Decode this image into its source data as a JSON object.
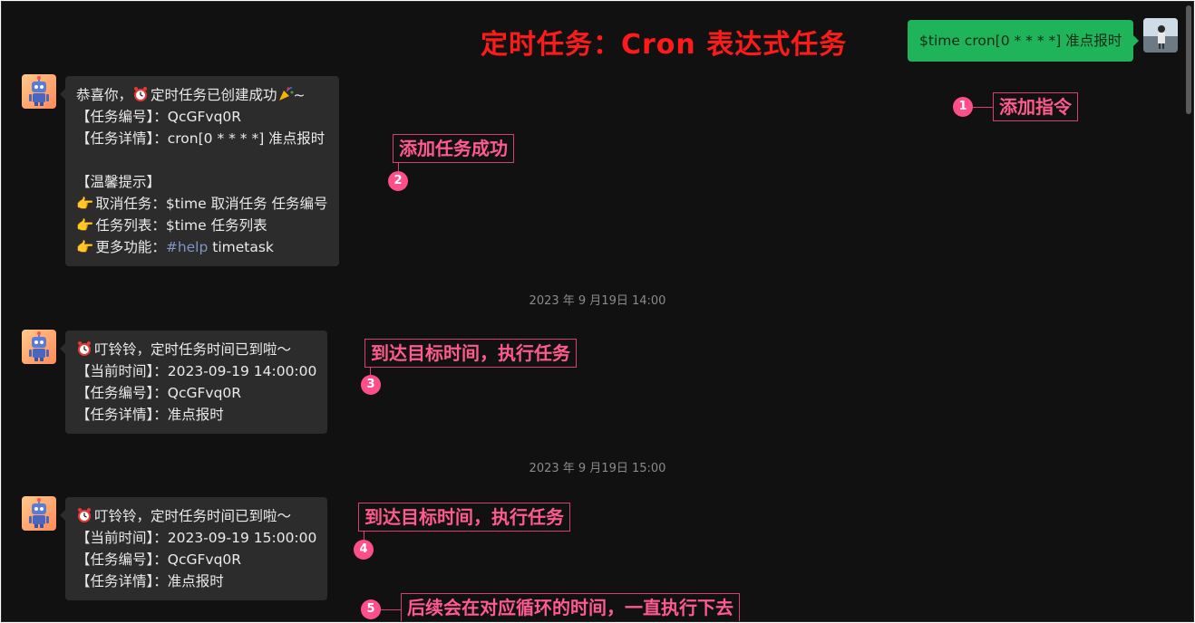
{
  "title": "定时任务：Cron 表达式任务",
  "user_message": "$time cron[0 * * * *] 准点报时",
  "messages": [
    {
      "lines": [
        "恭喜你，",
        "定时任务已创建成功",
        "~",
        "【任务编号】：QcGFvq0R",
        "【任务详情】：cron[0 * * * *] 准点报时",
        "【温馨提示】",
        "取消任务：$time 取消任务 任务编号",
        "任务列表：$time 任务列表",
        "更多功能：",
        "#help",
        " timetask"
      ]
    },
    {
      "timestamp": "2023 年 9 月19日 14:00",
      "lines": [
        "叮铃铃，定时任务时间已到啦～",
        "【当前时间】：2023-09-19 14:00:00",
        "【任务编号】：QcGFvq0R",
        "【任务详情】：准点报时"
      ]
    },
    {
      "timestamp": "2023 年 9 月19日 15:00",
      "lines": [
        "叮铃铃，定时任务时间已到啦～",
        "【当前时间】：2023-09-19 15:00:00",
        "【任务编号】：QcGFvq0R",
        "【任务详情】：准点报时"
      ]
    }
  ],
  "annotations": [
    {
      "num": "1",
      "text": "添加指令"
    },
    {
      "num": "2",
      "text": "添加任务成功"
    },
    {
      "num": "3",
      "text": "到达目标时间，执行任务"
    },
    {
      "num": "4",
      "text": "到达目标时间，执行任务"
    },
    {
      "num": "5",
      "text": "后续会在对应循环的时间，一直执行下去"
    }
  ],
  "icons": {
    "bot_avatar": "robot-icon",
    "user_avatar": "user-photo",
    "clock": "alarm-clock-icon",
    "point": "pointing-hand-icon",
    "party": "party-popper-icon"
  },
  "colors": {
    "background": "#111111",
    "bubble_left": "#2c2c2c",
    "bubble_right": "#1fb45a",
    "title": "#ff1a1a",
    "annotation": "#ff5a8f",
    "hashtag": "#7f95c5"
  }
}
